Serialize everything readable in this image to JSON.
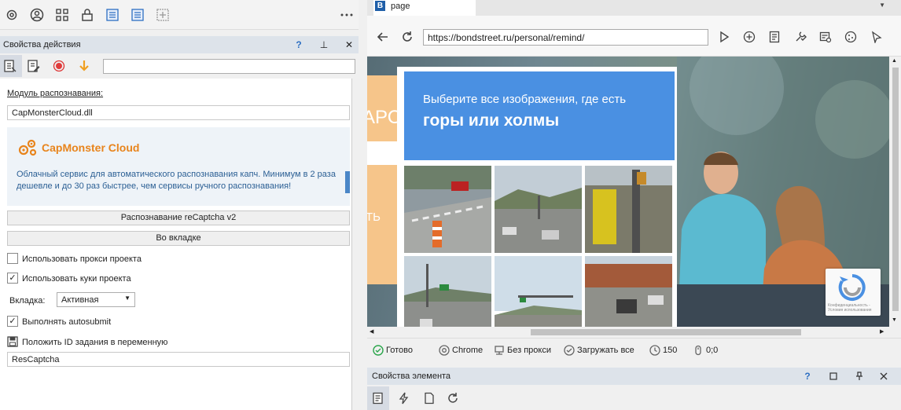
{
  "action_props": {
    "title": "Свойства действия",
    "help": "?",
    "pin": "⊥",
    "close": "✕",
    "search_value": "",
    "module_label": "Модуль распознавания:",
    "module_value": "CapMonsterCloud.dll",
    "capmonster": {
      "title": "CapMonster Cloud",
      "description": "Облачный сервис для автоматического распознавания капч. Минимум в 2 раза дешевле и до 30 раз быстрее, чем сервисы ручного распознавания!"
    },
    "mode_button": "Распознавание reCaptcha v2",
    "tab_button": "Во вкладке",
    "use_proxy": {
      "label": "Использовать прокси проекта",
      "checked": false
    },
    "use_cookies": {
      "label": "Использовать куки проекта",
      "checked": true
    },
    "tab_label": "Вкладка:",
    "tab_value": "Активная",
    "autosubmit": {
      "label": "Выполнять autosubmit",
      "checked": true
    },
    "save_id_label": "Положить ID задания в переменную",
    "save_id_value": "ResCaptcha"
  },
  "browser": {
    "tab_title": "page",
    "tab_icon_letter": "B",
    "url": "https://bondstreet.ru/personal/remind/",
    "site_fragment_1": "АРС",
    "site_fragment_2": "ТЬ",
    "captcha": {
      "line1": "Выберите все изображения, где есть",
      "line2": "горы или холмы"
    },
    "recaptcha_badge": "Конфиденциальность - Условия использования"
  },
  "status": {
    "ready": "Готово",
    "browser": "Chrome",
    "proxy": "Без прокси",
    "load": "Загружать все",
    "count": "150",
    "coords": "0;0"
  },
  "element_props": {
    "title": "Свойства элемента",
    "help": "?"
  },
  "colors": {
    "accent_blue": "#4a90e2",
    "capmonster_orange": "#e8841c",
    "status_green": "#2aa54b"
  }
}
